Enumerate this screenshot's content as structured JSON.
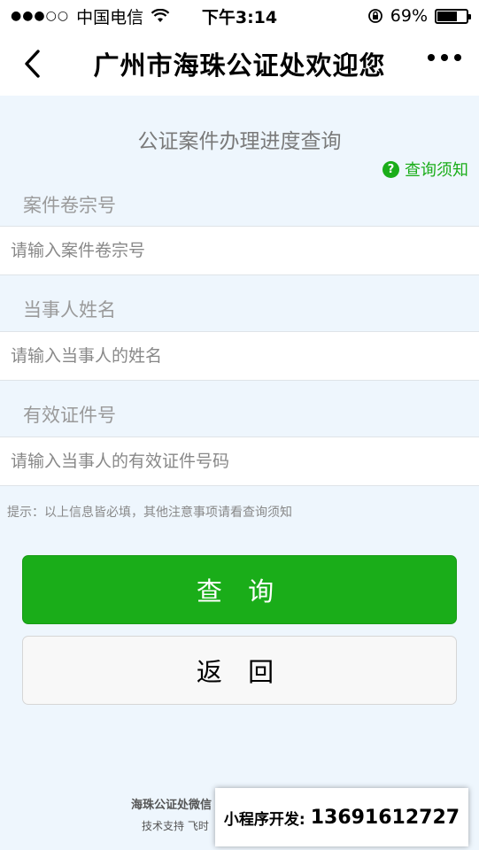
{
  "status_bar": {
    "signal": "●●●○○",
    "carrier": "中国电信",
    "time": "下午3:14",
    "battery_percent": "69%",
    "battery_level": 0.69
  },
  "nav": {
    "title": "广州市海珠公证处欢迎您"
  },
  "form": {
    "title": "公证案件办理进度查询",
    "help_link": "查询须知",
    "fields": [
      {
        "label": "案件卷宗号",
        "placeholder": "请输入案件卷宗号",
        "value": ""
      },
      {
        "label": "当事人姓名",
        "placeholder": "请输入当事人的姓名",
        "value": ""
      },
      {
        "label": "有效证件号",
        "placeholder": "请输入当事人的有效证件号码",
        "value": ""
      }
    ],
    "hint": "提示：以上信息皆必填，其他注意事项请看查询须知",
    "query_button": "查 询",
    "back_button": "返 回"
  },
  "footer": {
    "line1": "海珠公证处微信",
    "line2": "技术支持 飞时"
  },
  "overlay": {
    "label": "小程序开发:",
    "phone": "13691612727"
  },
  "colors": {
    "accent": "#1aad19",
    "background": "#eef6fd"
  }
}
